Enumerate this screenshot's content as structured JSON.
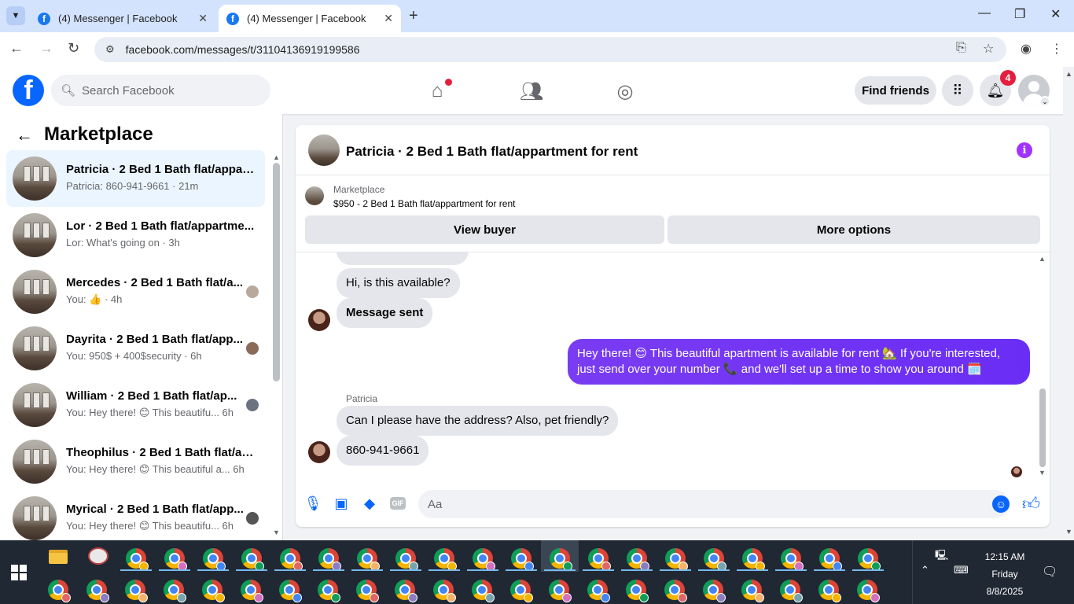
{
  "browser": {
    "tabs": [
      {
        "title": "(4) Messenger | Facebook",
        "active": false
      },
      {
        "title": "(4) Messenger | Facebook",
        "active": true
      }
    ],
    "url": "facebook.com/messages/t/31104136919199586"
  },
  "fb": {
    "search_placeholder": "Search Facebook",
    "find_friends": "Find friends",
    "notification_count": "4"
  },
  "sidebar": {
    "title": "Marketplace",
    "conversations": [
      {
        "name": "Patricia · 2 Bed 1 Bath flat/appar...",
        "snippet": "Patricia: 860-941-9661 · 21m",
        "selected": true
      },
      {
        "name": "Lor · 2 Bed 1 Bath flat/appartme...",
        "snippet": "Lor: What's going on · 3h"
      },
      {
        "name": "Mercedes · 2 Bed 1 Bath flat/a...",
        "snippet": "You: 👍 · 4h"
      },
      {
        "name": "Dayrita · 2 Bed 1 Bath flat/app...",
        "snippet": "You: 950$ + 400$security · 6h"
      },
      {
        "name": "William · 2 Bed 1 Bath flat/ap...",
        "snippet": "You: Hey there! 😊 This beautifu...  6h"
      },
      {
        "name": "Theophilus · 2 Bed 1 Bath flat/ap...",
        "snippet": "You: Hey there! 😊 This beautiful a...  6h"
      },
      {
        "name": "Myrical · 2 Bed 1 Bath flat/app...",
        "snippet": "You: Hey there! 😊 This beautifu...  6h"
      }
    ]
  },
  "chat": {
    "title": "Patricia · 2 Bed 1 Bath flat/appartment for rent",
    "marketplace_label": "Marketplace",
    "listing": "$950 - 2 Bed 1 Bath flat/appartment for rent",
    "view_buyer": "View buyer",
    "more_options": "More options",
    "messages": {
      "m1": "Hi, is this available?",
      "m2": "Message sent",
      "m3": "Hey there! 😊 This beautiful apartment is available for rent 🏡 If you're interested, just send over your number 📞 and we'll set up a time to show you around 🗓️",
      "sender": "Patricia",
      "m4": "Can I please have the address?  Also, pet friendly?",
      "m5": "860-941-9661"
    },
    "composer_placeholder": "Aa"
  },
  "taskbar": {
    "time": "12:15 AM",
    "day": "Friday",
    "date": "8/8/2025"
  }
}
